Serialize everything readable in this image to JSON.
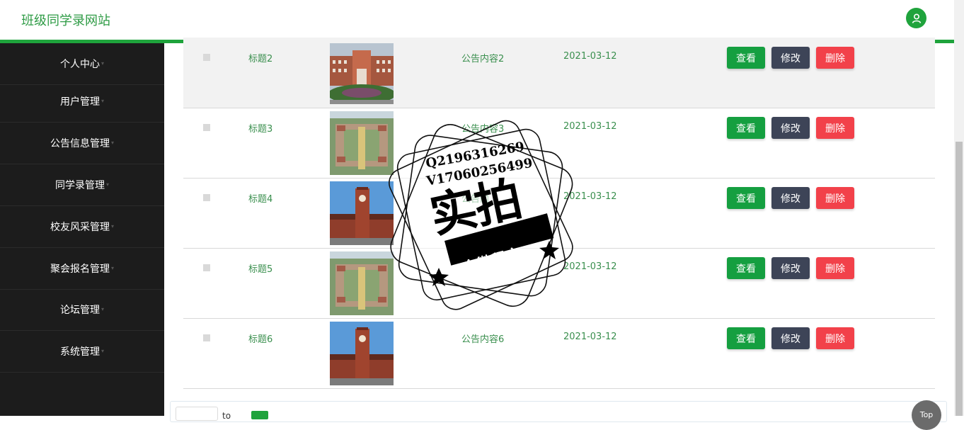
{
  "header": {
    "site_title": "班级同学录网站",
    "avatar_icon": "user-icon"
  },
  "sidebar": {
    "items": [
      {
        "label": "个人中心"
      },
      {
        "label": "用户管理"
      },
      {
        "label": "公告信息管理"
      },
      {
        "label": "同学录管理"
      },
      {
        "label": "校友风采管理"
      },
      {
        "label": "聚会报名管理"
      },
      {
        "label": "论坛管理"
      },
      {
        "label": "系统管理"
      }
    ]
  },
  "table": {
    "rows": [
      {
        "title": "标题2",
        "content": "公告内容2",
        "date": "2021-03-12",
        "image": "school-campus-photo"
      },
      {
        "title": "标题3",
        "content": "公告内容3",
        "date": "2021-03-12",
        "image": "campus-aerial-photo"
      },
      {
        "title": "标题4",
        "content": "公告内",
        "date": "2021-03-12",
        "image": "clock-tower-photo"
      },
      {
        "title": "标题5",
        "content": "",
        "date": "2021-03-12",
        "image": "campus-aerial-photo"
      },
      {
        "title": "标题6",
        "content": "公告内容6",
        "date": "2021-03-12",
        "image": "clock-tower-photo"
      }
    ],
    "actions": {
      "view": "查看",
      "edit": "修改",
      "delete": "删除"
    }
  },
  "pager": {
    "text": "to",
    "top_label": "Top"
  },
  "watermark": {
    "line1": "Q2196316269",
    "line2": "V17060256499",
    "big": "实拍",
    "small": "全微程序"
  },
  "colors": {
    "brand_green": "#1fa33c",
    "sidebar_bg": "#1c1c1c",
    "delete_red": "#f2414a",
    "edit_slate": "#3d4457"
  }
}
